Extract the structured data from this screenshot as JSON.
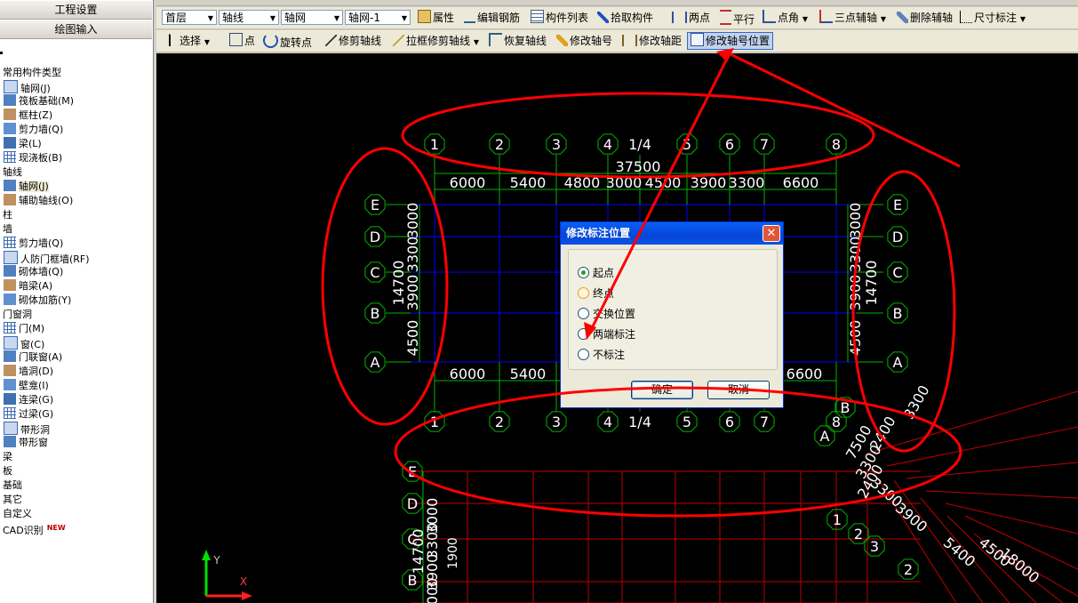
{
  "left_panel": {
    "tab_project": "工程设置",
    "tab_drawing": "绘图输入",
    "tree": [
      {
        "type": "cat",
        "label": "常用构件类型"
      },
      {
        "type": "item",
        "label": "轴网(J)",
        "icon": "grid-icon"
      },
      {
        "type": "item",
        "label": "筏板基础(M)",
        "icon": "raft-icon"
      },
      {
        "type": "item",
        "label": "框柱(Z)",
        "icon": "column-icon"
      },
      {
        "type": "item",
        "label": "剪力墙(Q)",
        "icon": "wall-icon"
      },
      {
        "type": "item",
        "label": "梁(L)",
        "icon": "beam-icon"
      },
      {
        "type": "item",
        "label": "现浇板(B)",
        "icon": "slab-icon"
      },
      {
        "type": "cat",
        "label": "轴线"
      },
      {
        "type": "item",
        "label": "轴网(J)",
        "icon": "grid-icon",
        "selected": true
      },
      {
        "type": "item",
        "label": "辅助轴线(O)",
        "icon": "aux-axis-icon"
      },
      {
        "type": "cat",
        "label": "柱"
      },
      {
        "type": "cat",
        "label": "墙"
      },
      {
        "type": "item",
        "label": "剪力墙(Q)",
        "icon": "wall-icon"
      },
      {
        "type": "item",
        "label": "人防门框墙(RF)",
        "icon": "door-frame-icon"
      },
      {
        "type": "item",
        "label": "砌体墙(Q)",
        "icon": "masonry-icon"
      },
      {
        "type": "item",
        "label": "暗梁(A)",
        "icon": "hidden-beam-icon"
      },
      {
        "type": "item",
        "label": "砌体加筋(Y)",
        "icon": "rebar-icon"
      },
      {
        "type": "cat",
        "label": "门窗洞"
      },
      {
        "type": "item",
        "label": "门(M)",
        "icon": "door-icon"
      },
      {
        "type": "item",
        "label": "窗(C)",
        "icon": "window-icon"
      },
      {
        "type": "item",
        "label": "门联窗(A)",
        "icon": "door-window-icon"
      },
      {
        "type": "item",
        "label": "墙洞(D)",
        "icon": "opening-icon"
      },
      {
        "type": "item",
        "label": "壁龛(I)",
        "icon": "niche-icon"
      },
      {
        "type": "item",
        "label": "连梁(G)",
        "icon": "link-beam-icon"
      },
      {
        "type": "item",
        "label": "过梁(G)",
        "icon": "lintel-icon"
      },
      {
        "type": "item",
        "label": "带形洞",
        "icon": "strip-opening-icon"
      },
      {
        "type": "item",
        "label": "带形窗",
        "icon": "strip-window-icon"
      },
      {
        "type": "cat",
        "label": "梁"
      },
      {
        "type": "cat",
        "label": "板"
      },
      {
        "type": "cat",
        "label": "基础"
      },
      {
        "type": "cat",
        "label": "其它"
      },
      {
        "type": "cat",
        "label": "自定义"
      },
      {
        "type": "cat",
        "label": "CAD识别",
        "badge": "NEW"
      }
    ]
  },
  "toolbar1": {
    "floor": "首层",
    "category": "轴线",
    "type": "轴网",
    "instance": "轴网-1",
    "properties": "属性",
    "edit_rebar": "编辑钢筋",
    "member_list": "构件列表",
    "pick_member": "拾取构件",
    "two_points": "两点",
    "parallel": "平行",
    "point_angle": "点角",
    "three_point_aux": "三点辅轴",
    "delete_aux": "删除辅轴",
    "dimension": "尺寸标注"
  },
  "toolbar2": {
    "select": "选择",
    "point": "点",
    "rotate_point": "旋转点",
    "trim_axis": "修剪轴线",
    "box_trim_axis": "拉框修剪轴线",
    "restore_axis": "恢复轴线",
    "modify_axis_no": "修改轴号",
    "modify_axis_dist": "修改轴距",
    "modify_axis_label_pos": "修改轴号位置"
  },
  "dialog": {
    "title": "修改标注位置",
    "options": [
      "起点",
      "终点",
      "交换位置",
      "两端标注",
      "不标注"
    ],
    "selected_index": 0,
    "ok": "确定",
    "cancel": "取消"
  },
  "cad": {
    "top_axes": [
      "1",
      "2",
      "3",
      "4",
      "1/4",
      "5",
      "6",
      "7",
      "8"
    ],
    "left_axes": [
      "E",
      "D",
      "C",
      "B",
      "A"
    ],
    "top_total": "37500",
    "top_dims": [
      "6000",
      "5400",
      "4800",
      "3000",
      "4500",
      "3900",
      "3300",
      "6600"
    ],
    "side_total": "14700",
    "side_dims": [
      "3000",
      "3300",
      "3900",
      "4500"
    ],
    "bottom_dims": [
      "6000",
      "5400",
      "6600"
    ],
    "lower_axes": [
      "E",
      "D",
      "C",
      "B"
    ],
    "lower_side_dims": [
      "3000",
      "3300",
      "3900",
      "1900"
    ],
    "lower_side_total": "14700",
    "rot_labels": [
      "7500",
      "3300",
      "2400",
      "3300",
      "2400",
      "3300",
      "3900",
      "5400",
      "4500",
      "18000"
    ],
    "rot_axes": [
      "B",
      "A",
      "1",
      "2",
      "3",
      "2"
    ],
    "ucs_y": "Y",
    "ucs_x": "X"
  },
  "colors": {
    "axis_green": "#00b400",
    "dim_blue": "#0000ff",
    "annot_red": "#ff0000",
    "grid_red": "#c00000"
  }
}
